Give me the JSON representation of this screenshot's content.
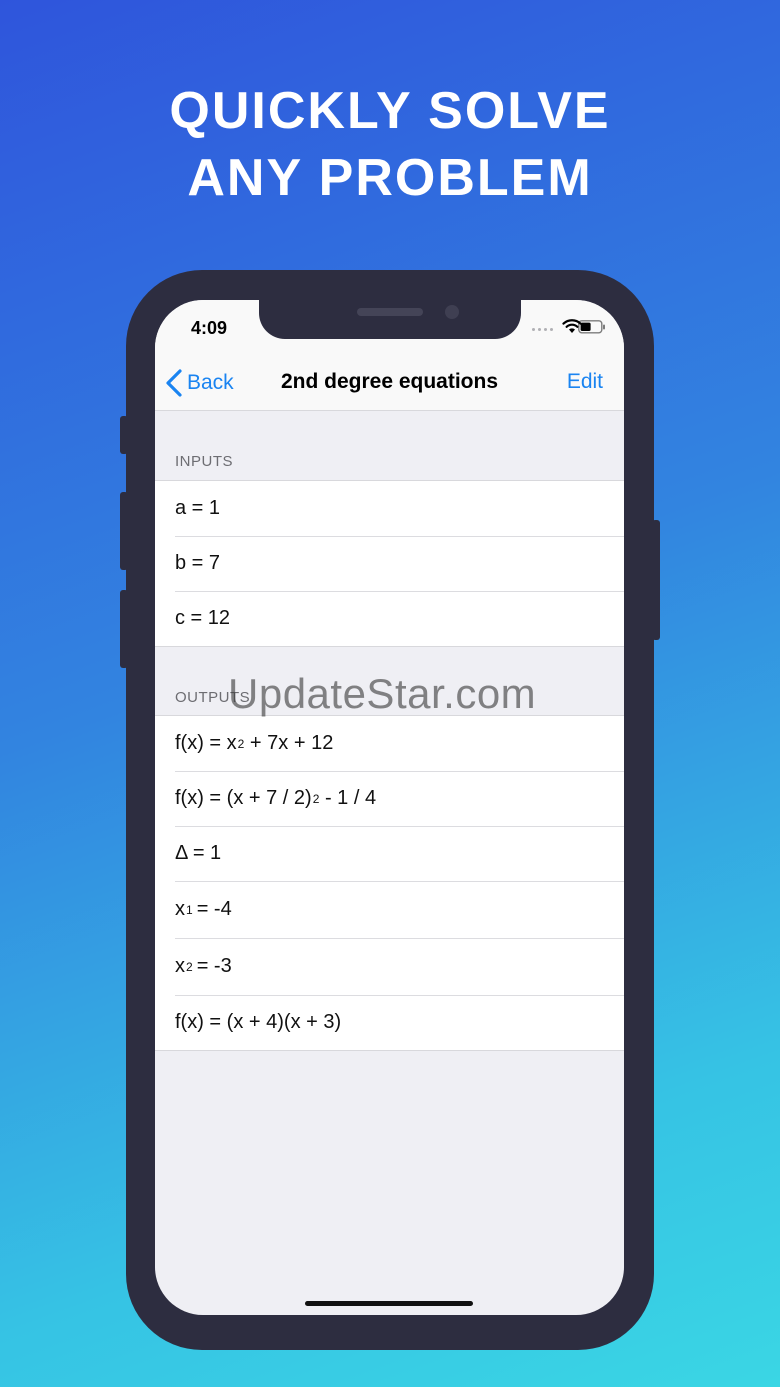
{
  "headline": {
    "line1": "QUICKLY SOLVE",
    "line2": "ANY PROBLEM"
  },
  "status_bar": {
    "time": "4:09"
  },
  "nav": {
    "back_label": "Back",
    "title": "2nd degree equations",
    "edit_label": "Edit"
  },
  "inputs": {
    "header": "INPUTS",
    "rows": [
      {
        "text": "a = 1"
      },
      {
        "text": "b = 7"
      },
      {
        "text": "c = 12"
      }
    ]
  },
  "outputs": {
    "header": "OUTPUTS",
    "f_expanded": {
      "a": "f(x) = x",
      "sup": "2",
      "b": " + 7x + 12"
    },
    "f_canonical": {
      "a": "f(x) = (x + 7 / 2)",
      "sup": "2",
      "b": " - 1 / 4"
    },
    "delta": "Δ = 1",
    "x1": {
      "a": "x",
      "sub": "1",
      "b": "= -4"
    },
    "x2": {
      "a": "x",
      "sub": "2",
      "b": "= -3"
    },
    "f_factored": "f(x) = (x + 4)(x + 3)"
  },
  "watermark": "UpdateStar.com",
  "colors": {
    "accent": "#1a84f1",
    "phone_frame": "#2d2d40",
    "background_top": "#2f55dc",
    "background_bottom": "#3ad6e4"
  }
}
